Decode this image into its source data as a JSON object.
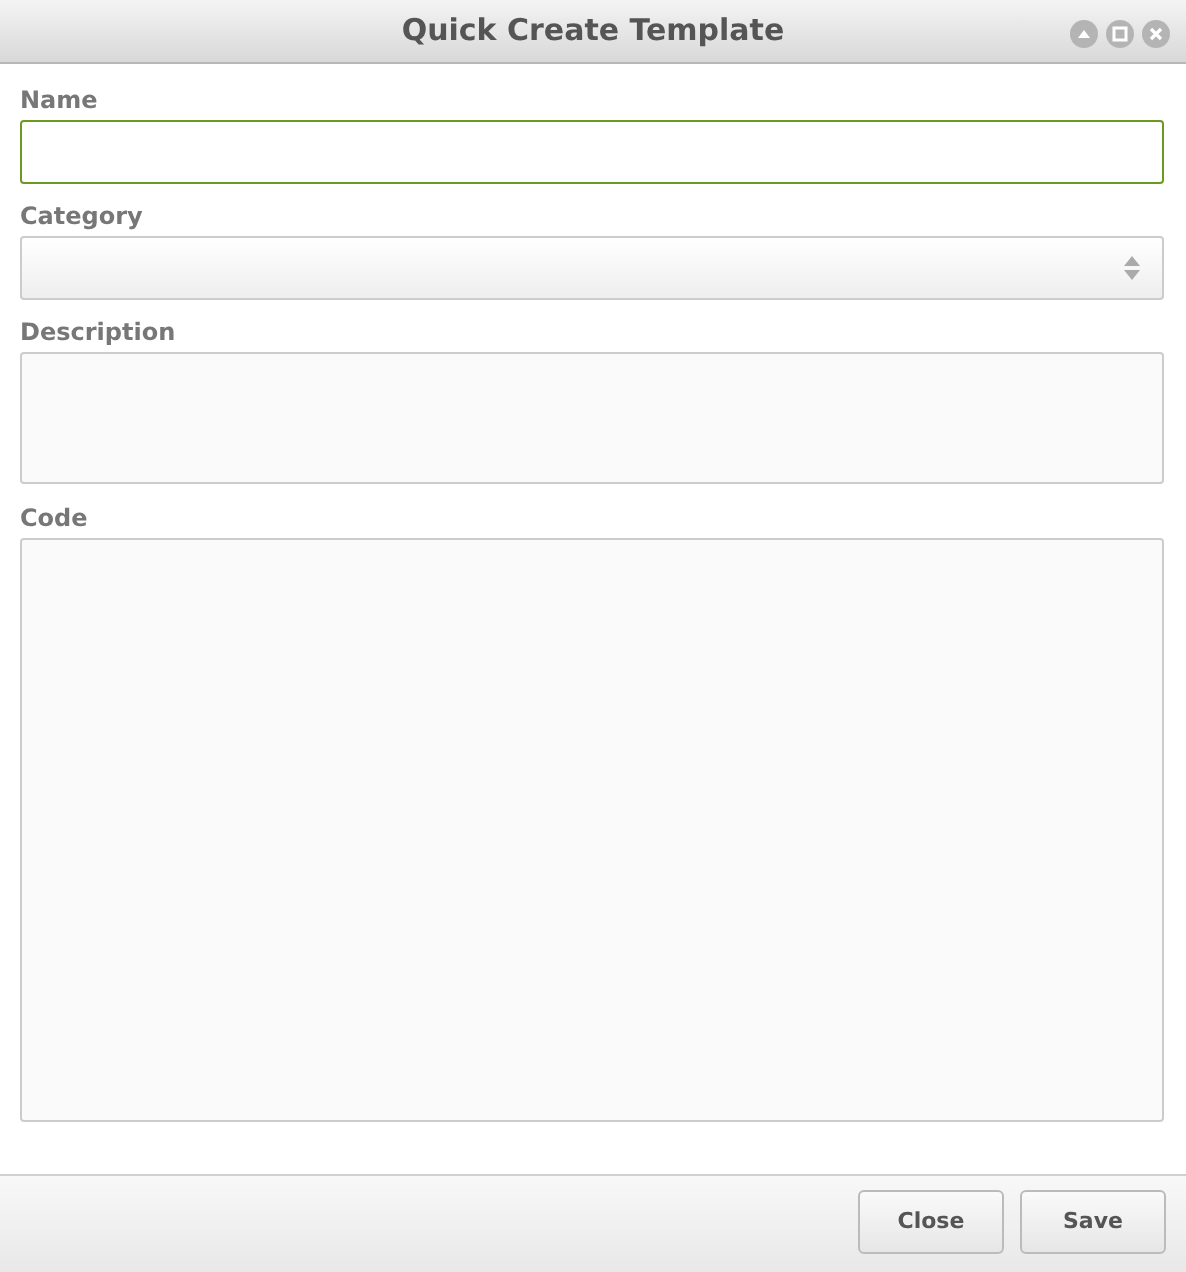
{
  "window": {
    "title": "Quick Create Template"
  },
  "fields": [
    {
      "label": "Name",
      "kind": "text",
      "focused": true
    },
    {
      "label": "Category",
      "kind": "select",
      "focused": false
    },
    {
      "label": "Description",
      "kind": "textarea",
      "focused": false
    },
    {
      "label": "Code",
      "kind": "code",
      "focused": false
    }
  ],
  "buttons": [
    "Close",
    "Save"
  ]
}
